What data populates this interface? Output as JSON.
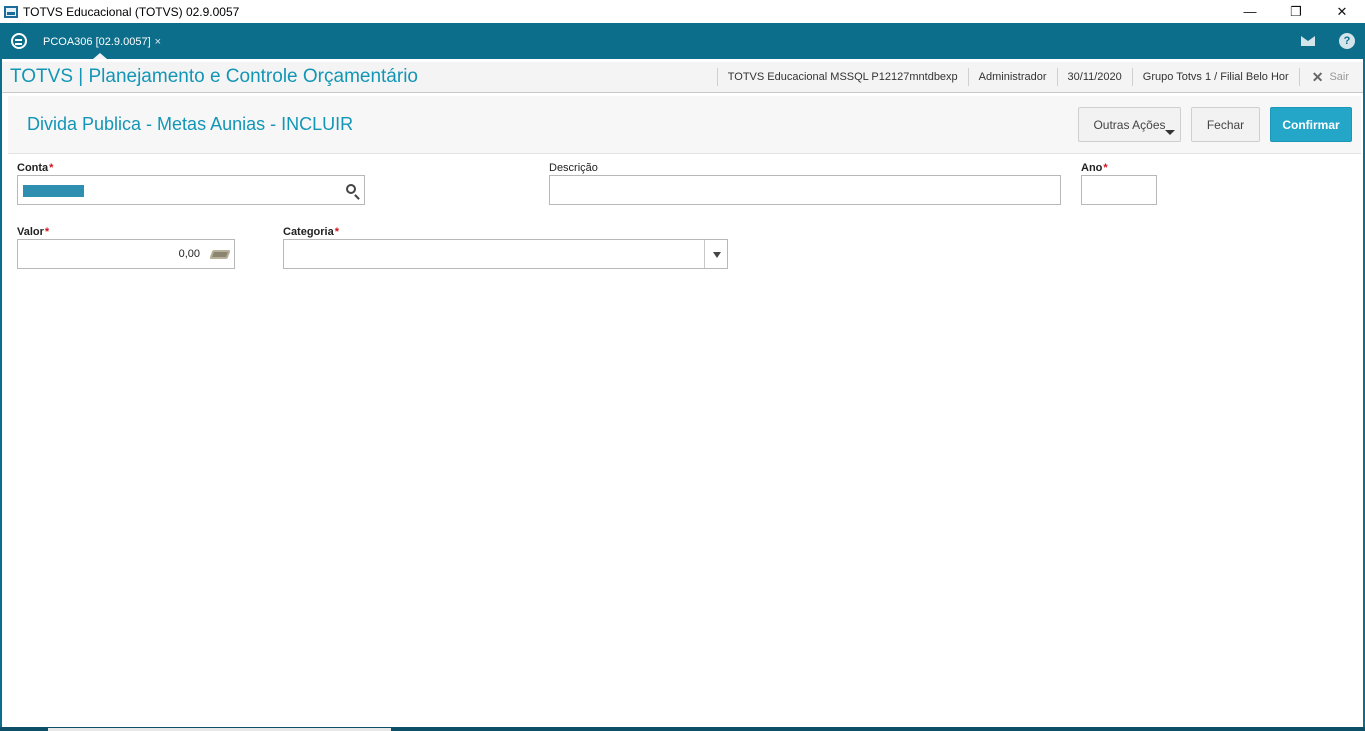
{
  "window": {
    "title": "TOTVS Educacional (TOTVS) 02.9.0057",
    "controls": {
      "minimize": "—",
      "restore": "❐",
      "close": "✕"
    }
  },
  "tabbar": {
    "tab_label": "PCOA306 [02.9.0057]",
    "tab_close": "×",
    "help_symbol": "?"
  },
  "header": {
    "app_title": "TOTVS | Planejamento e Controle Orçamentário",
    "environment": "TOTVS Educacional MSSQL P12127mntdbexp",
    "user": "Administrador",
    "date": "30/11/2020",
    "branch": "Grupo Totvs 1 / Filial Belo Hor",
    "logout_label": "Sair"
  },
  "form": {
    "title": "Divida Publica - Metas Aunias - INCLUIR",
    "buttons": {
      "other_actions": "Outras Ações",
      "close": "Fechar",
      "confirm": "Confirmar"
    },
    "required_mark": "*",
    "fields": {
      "conta_label": "Conta",
      "descricao_label": "Descrição",
      "ano_label": "Ano",
      "valor_label": "Valor",
      "valor_value": "0,00",
      "categoria_label": "Categoria"
    }
  },
  "colors": {
    "brand_teal": "#0d6e8b",
    "accent_blue": "#1396b6",
    "confirm_button": "#24a6c9",
    "required_red": "#d0121b"
  }
}
